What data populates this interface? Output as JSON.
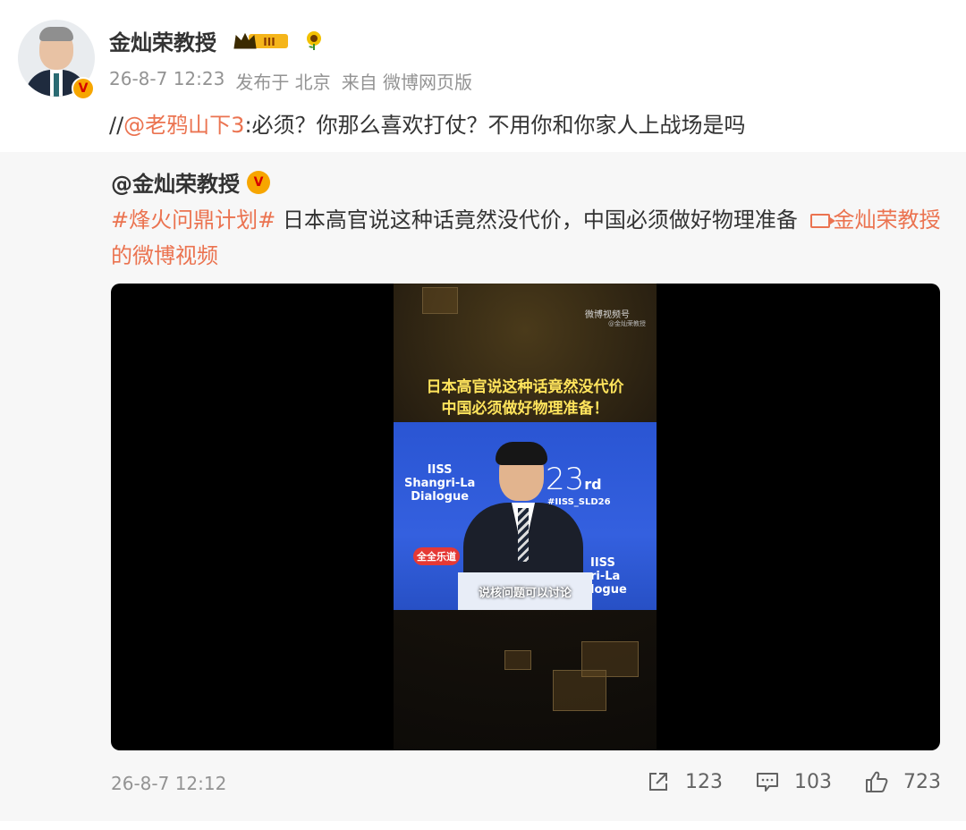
{
  "post": {
    "username": "金灿荣教授",
    "timestamp": "26-8-7 12:23",
    "publish_location": "发布于 北京",
    "source": "来自 微博网页版",
    "repost_prefix": "//",
    "repost_mention": "@老鸦山下3",
    "repost_text": ":必须？你那么喜欢打仗？不用你和你家人上战场是吗",
    "crown_level": "III"
  },
  "quoted": {
    "author": "@金灿荣教授",
    "topic": "#烽火问鼎计划#",
    "text": " 日本高官说这种话竟然没代价，中国必须做好物理准备",
    "video_link": "金灿荣教授的微博视频",
    "timestamp": "26-8-7 12:12",
    "video": {
      "watermark": "微博视频号",
      "watermark_sub": "@金灿荣教授",
      "caption_line1": "日本高官说这种话竟然没代价",
      "caption_line2": "中国必须做好物理准备！",
      "logo_left": "IISS\nShangri-La\nDialogue",
      "logo_number": "23",
      "logo_suffix": "rd",
      "hashtag": "#IISS_SLD26",
      "logo_right": "IISS\nri-La\nlogue",
      "sticker": "全全乐道",
      "subtitle": "说核问题可以讨论"
    },
    "actions": {
      "shares": "123",
      "comments": "103",
      "likes": "723"
    }
  }
}
